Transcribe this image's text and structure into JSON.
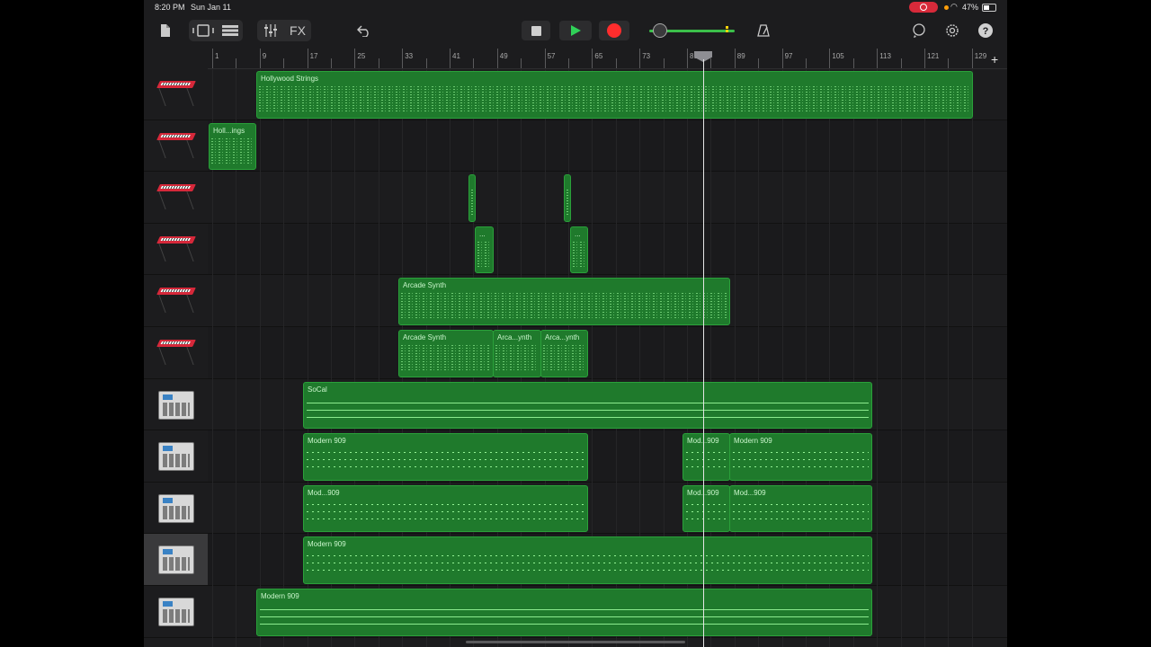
{
  "status_bar": {
    "time": "8:20 PM",
    "date": "Sun Jan 11",
    "battery": "47%"
  },
  "toolbar": {
    "fx_label": "FX",
    "icons": [
      "document-icon",
      "browser-view-icon",
      "tracks-view-icon",
      "mixer-icon",
      "undo-icon",
      "stop-icon",
      "play-icon",
      "record-icon",
      "metronome-icon",
      "loop-icon",
      "settings-icon",
      "help-icon"
    ],
    "play_color": "#30d158",
    "record_color": "#ff2d2d"
  },
  "ruler": {
    "bars": [
      "1",
      "9",
      "17",
      "25",
      "33",
      "41",
      "49",
      "57",
      "65",
      "73",
      "81",
      "89",
      "97",
      "105",
      "113",
      "121",
      "129"
    ]
  },
  "tracks": [
    {
      "instrument": "keyboard",
      "regions": [
        "Hollywood Strings"
      ]
    },
    {
      "instrument": "keyboard",
      "regions": [
        "Holl...ings"
      ]
    },
    {
      "instrument": "keyboard",
      "regions": [
        "",
        ""
      ]
    },
    {
      "instrument": "keyboard",
      "regions": [
        "...",
        "..."
      ]
    },
    {
      "instrument": "keyboard",
      "regions": [
        "Arcade Synth"
      ]
    },
    {
      "instrument": "keyboard",
      "regions": [
        "Arcade Synth",
        "Arca...ynth",
        "Arca...ynth"
      ]
    },
    {
      "instrument": "drum-machine",
      "regions": [
        "SoCal"
      ]
    },
    {
      "instrument": "drum-machine",
      "regions": [
        "Modern 909",
        "Mod...909",
        "Modern 909"
      ]
    },
    {
      "instrument": "drum-machine",
      "regions": [
        "Mod...909",
        "Mod...909",
        "Mod...909"
      ]
    },
    {
      "instrument": "drum-machine",
      "regions": [
        "Modern 909"
      ]
    },
    {
      "instrument": "drum-machine",
      "regions": [
        "Modern 909"
      ]
    }
  ],
  "colors": {
    "region_fill": "#1f7a2c",
    "region_border": "#2aa13a",
    "background": "#1c1c1e"
  }
}
